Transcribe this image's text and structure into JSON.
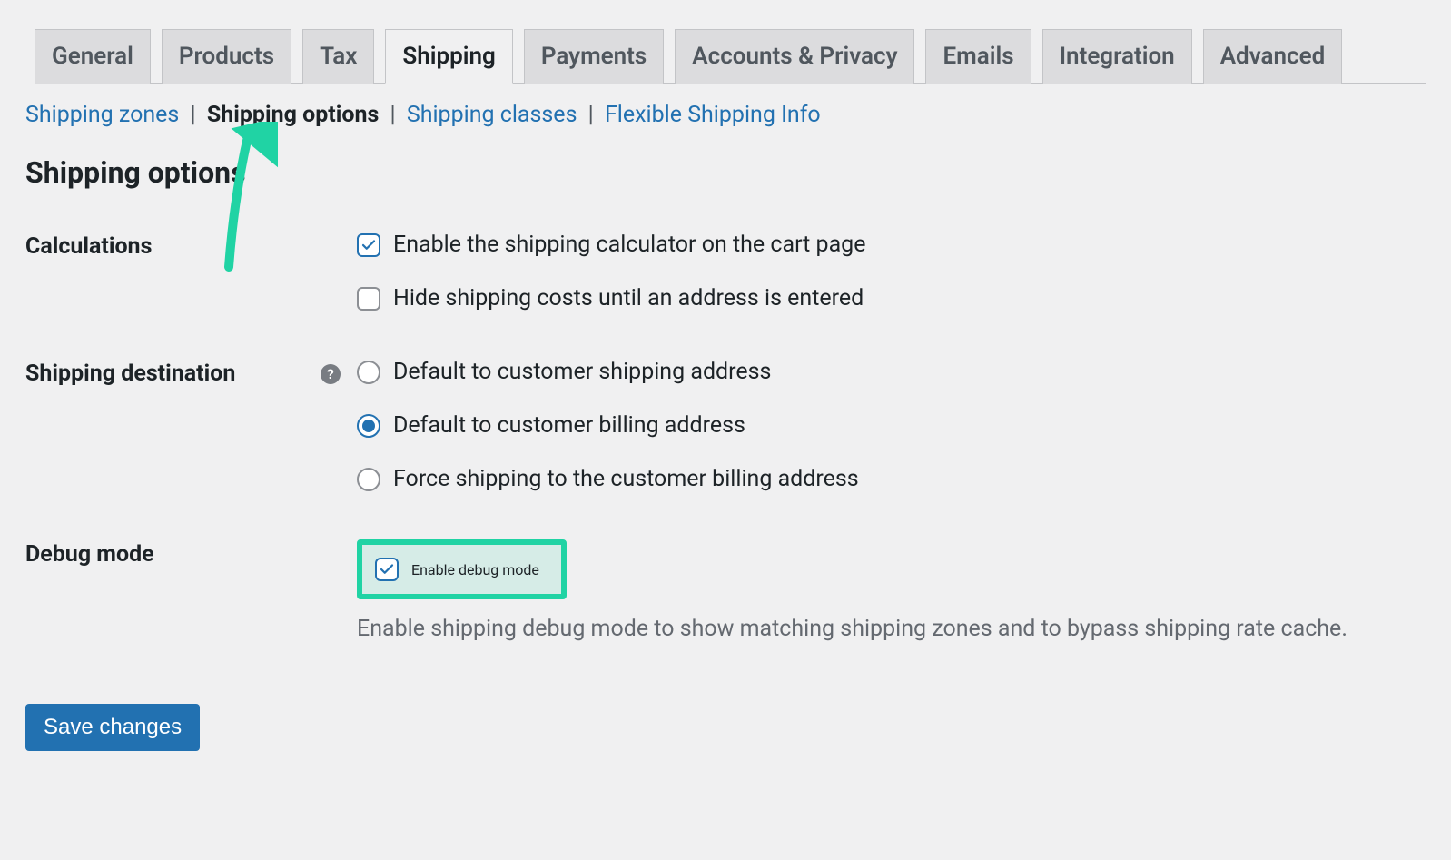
{
  "tabs": [
    {
      "label": "General"
    },
    {
      "label": "Products"
    },
    {
      "label": "Tax"
    },
    {
      "label": "Shipping",
      "active": true
    },
    {
      "label": "Payments"
    },
    {
      "label": "Accounts & Privacy"
    },
    {
      "label": "Emails"
    },
    {
      "label": "Integration"
    },
    {
      "label": "Advanced"
    }
  ],
  "subnav": {
    "zones": "Shipping zones",
    "options": "Shipping options",
    "classes": "Shipping classes",
    "flexible": "Flexible Shipping Info",
    "separator": "|"
  },
  "heading": "Shipping options",
  "sections": {
    "calculations": {
      "label": "Calculations",
      "enable_calculator": {
        "label": "Enable the shipping calculator on the cart page",
        "checked": true
      },
      "hide_costs": {
        "label": "Hide shipping costs until an address is entered",
        "checked": false
      }
    },
    "destination": {
      "label": "Shipping destination",
      "help": "?",
      "options": {
        "shipping": {
          "label": "Default to customer shipping address",
          "checked": false
        },
        "billing": {
          "label": "Default to customer billing address",
          "checked": true
        },
        "force_billing": {
          "label": "Force shipping to the customer billing address",
          "checked": false
        }
      }
    },
    "debug": {
      "label": "Debug mode",
      "enable": {
        "label": "Enable debug mode",
        "checked": true
      },
      "description": "Enable shipping debug mode to show matching shipping zones and to bypass shipping rate cache."
    }
  },
  "save_button": "Save changes",
  "annotation_color": "#20d3a4"
}
